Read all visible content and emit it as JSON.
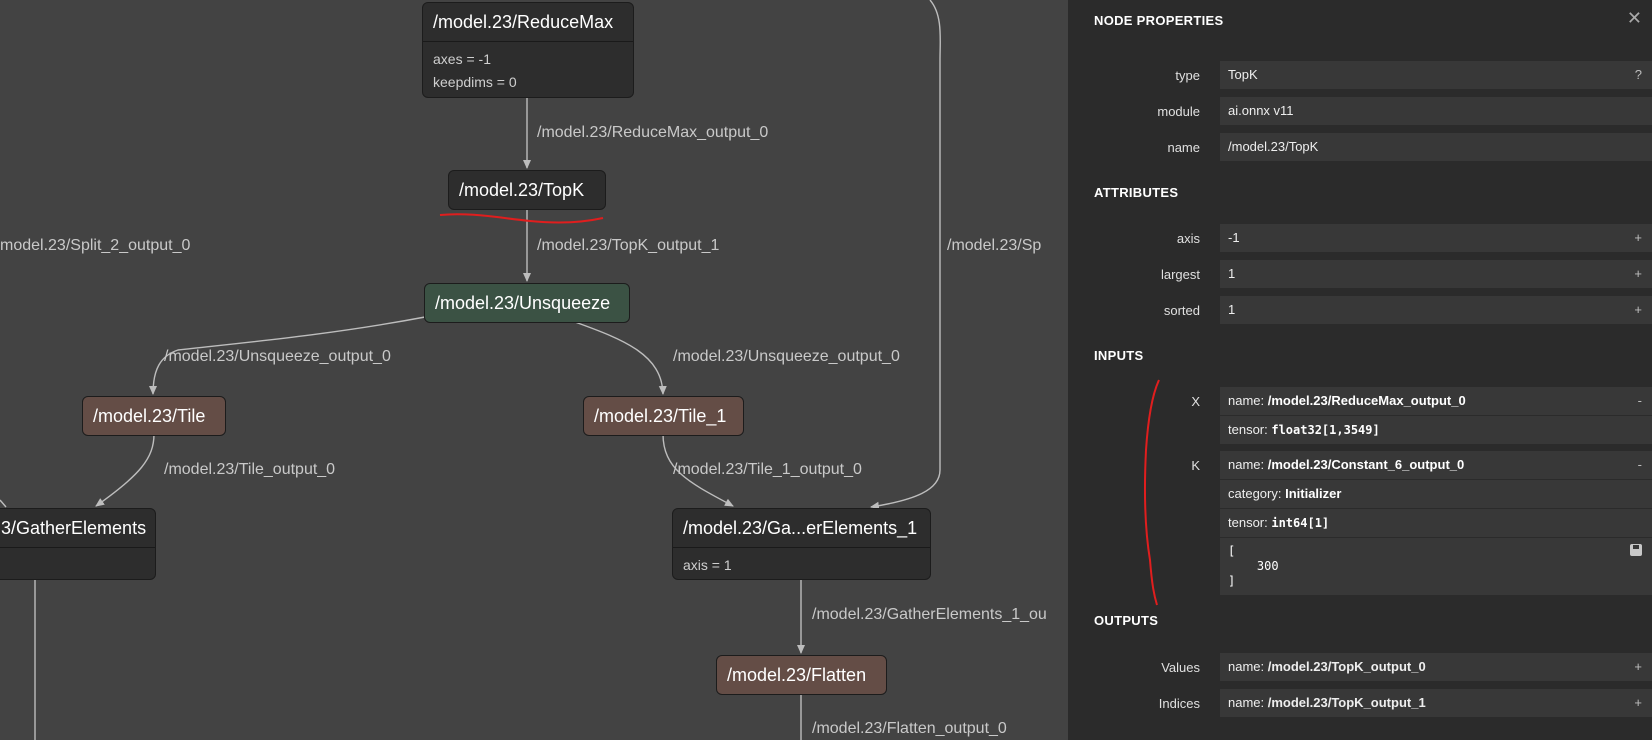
{
  "graph": {
    "nodes": {
      "reducemax": {
        "title": "/model.23/ReduceMax",
        "attrs": [
          "axes = -1",
          "keepdims = 0"
        ]
      },
      "topk": {
        "title": "/model.23/TopK"
      },
      "unsqueeze": {
        "title": "/model.23/Unsqueeze"
      },
      "tile": {
        "title": "/model.23/Tile"
      },
      "tile1": {
        "title": "/model.23/Tile_1"
      },
      "gather": {
        "title": "3/GatherElements"
      },
      "gather1": {
        "title": "/model.23/Ga...erElements_1",
        "attrs": [
          "axis = 1"
        ]
      },
      "flatten": {
        "title": "/model.23/Flatten"
      }
    },
    "edge_labels": {
      "reducemax_out": "/model.23/ReduceMax_output_0",
      "split2_out": "model.23/Split_2_output_0",
      "topk_out1": "/model.23/TopK_output_1",
      "split_right": "/model.23/Sp",
      "unsqueeze_left": "/model.23/Unsqueeze_output_0",
      "unsqueeze_right": "/model.23/Unsqueeze_output_0",
      "tile_out": "/model.23/Tile_output_0",
      "tile1_out": "/model.23/Tile_1_output_0",
      "gather1_out": "/model.23/GatherElements_1_ou",
      "flatten_out": "/model.23/Flatten_output_0"
    }
  },
  "panel": {
    "title": "NODE PROPERTIES",
    "close": "✕",
    "properties": [
      {
        "label": "type",
        "value": "TopK",
        "suffix": "?"
      },
      {
        "label": "module",
        "value": "ai.onnx v11",
        "suffix": ""
      },
      {
        "label": "name",
        "value": "/model.23/TopK",
        "suffix": ""
      }
    ],
    "attributes_title": "ATTRIBUTES",
    "attributes": [
      {
        "label": "axis",
        "value": "-1",
        "suffix": "+"
      },
      {
        "label": "largest",
        "value": "1",
        "suffix": "+"
      },
      {
        "label": "sorted",
        "value": "1",
        "suffix": "+"
      }
    ],
    "inputs_title": "INPUTS",
    "inputs": {
      "X": {
        "label": "X",
        "name_prefix": "name: ",
        "name": "/model.23/ReduceMax_output_0",
        "toggle": "-",
        "tensor_prefix": "tensor: ",
        "tensor": "float32[1,3549]"
      },
      "K": {
        "label": "K",
        "name_prefix": "name: ",
        "name": "/model.23/Constant_6_output_0",
        "toggle": "-",
        "category_prefix": "category: ",
        "category": "Initializer",
        "tensor_prefix": "tensor: ",
        "tensor": "int64[1]",
        "value_lines": [
          "[",
          "    300",
          "]"
        ]
      }
    },
    "outputs_title": "OUTPUTS",
    "outputs": [
      {
        "label": "Values",
        "name_prefix": "name: ",
        "name": "/model.23/TopK_output_0",
        "suffix": "+"
      },
      {
        "label": "Indices",
        "name_prefix": "name: ",
        "name": "/model.23/TopK_output_1",
        "suffix": "+"
      }
    ]
  },
  "colors": {
    "canvas": "#434343",
    "panel": "#2b2b2b",
    "node_dark": "#2d2d2d",
    "node_green": "#3b5244",
    "node_brown": "#644d46",
    "annotation": "#e01e1e"
  }
}
